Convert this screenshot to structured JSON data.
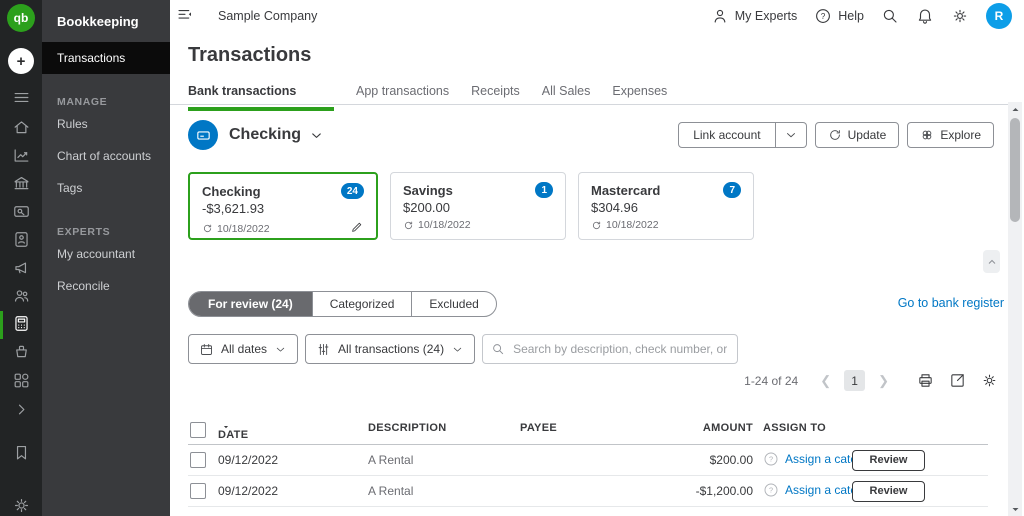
{
  "colors": {
    "brand_green": "#2ca01c",
    "link_blue": "#0077c5",
    "avatar_blue": "#0d9ee8",
    "dark_text": "#393a3d",
    "gray_text": "#6b6c72"
  },
  "rail": {
    "logo": "qb"
  },
  "sidebar": {
    "title": "Bookkeeping",
    "active_item": "Transactions",
    "manage_header": "MANAGE",
    "manage_items": [
      "Rules",
      "Chart of accounts",
      "Tags"
    ],
    "experts_header": "EXPERTS",
    "experts_items": [
      "My accountant",
      "Reconcile"
    ]
  },
  "topbar": {
    "company": "Sample Company",
    "my_experts": "My Experts",
    "help": "Help",
    "avatar_initial": "R"
  },
  "page": {
    "title": "Transactions",
    "tabs": [
      "Bank transactions",
      "App transactions",
      "Receipts",
      "All Sales",
      "Expenses"
    ]
  },
  "account_header": {
    "name": "Checking",
    "link_account": "Link account",
    "update": "Update",
    "explore": "Explore"
  },
  "cards": [
    {
      "name": "Checking",
      "badge": "24",
      "amount": "-$3,621.93",
      "updated": "10/18/2022"
    },
    {
      "name": "Savings",
      "badge": "1",
      "amount": "$200.00",
      "updated": "10/18/2022"
    },
    {
      "name": "Mastercard",
      "badge": "7",
      "amount": "$304.96",
      "updated": "10/18/2022"
    }
  ],
  "review_bar": {
    "segments": [
      "For review (24)",
      "Categorized",
      "Excluded"
    ],
    "register_link": "Go to bank register"
  },
  "filters": {
    "dates": "All dates",
    "transactions": "All transactions (24)",
    "search_placeholder": "Search by description, check number, or amount"
  },
  "pagination": {
    "range": "1-24 of 24",
    "page": "1",
    "prev": "❮",
    "next": "❯"
  },
  "table": {
    "headers": {
      "date": "DATE",
      "description": "DESCRIPTION",
      "payee": "PAYEE",
      "amount": "AMOUNT",
      "assign": "ASSIGN TO"
    },
    "rows": [
      {
        "date": "09/12/2022",
        "description": "A Rental",
        "payee": "",
        "amount": "$200.00",
        "assign_link": "Assign a cate",
        "review": "Review"
      },
      {
        "date": "09/12/2022",
        "description": "A Rental",
        "payee": "",
        "amount": "-$1,200.00",
        "assign_link": "Assign a cate",
        "review": "Review"
      }
    ]
  }
}
